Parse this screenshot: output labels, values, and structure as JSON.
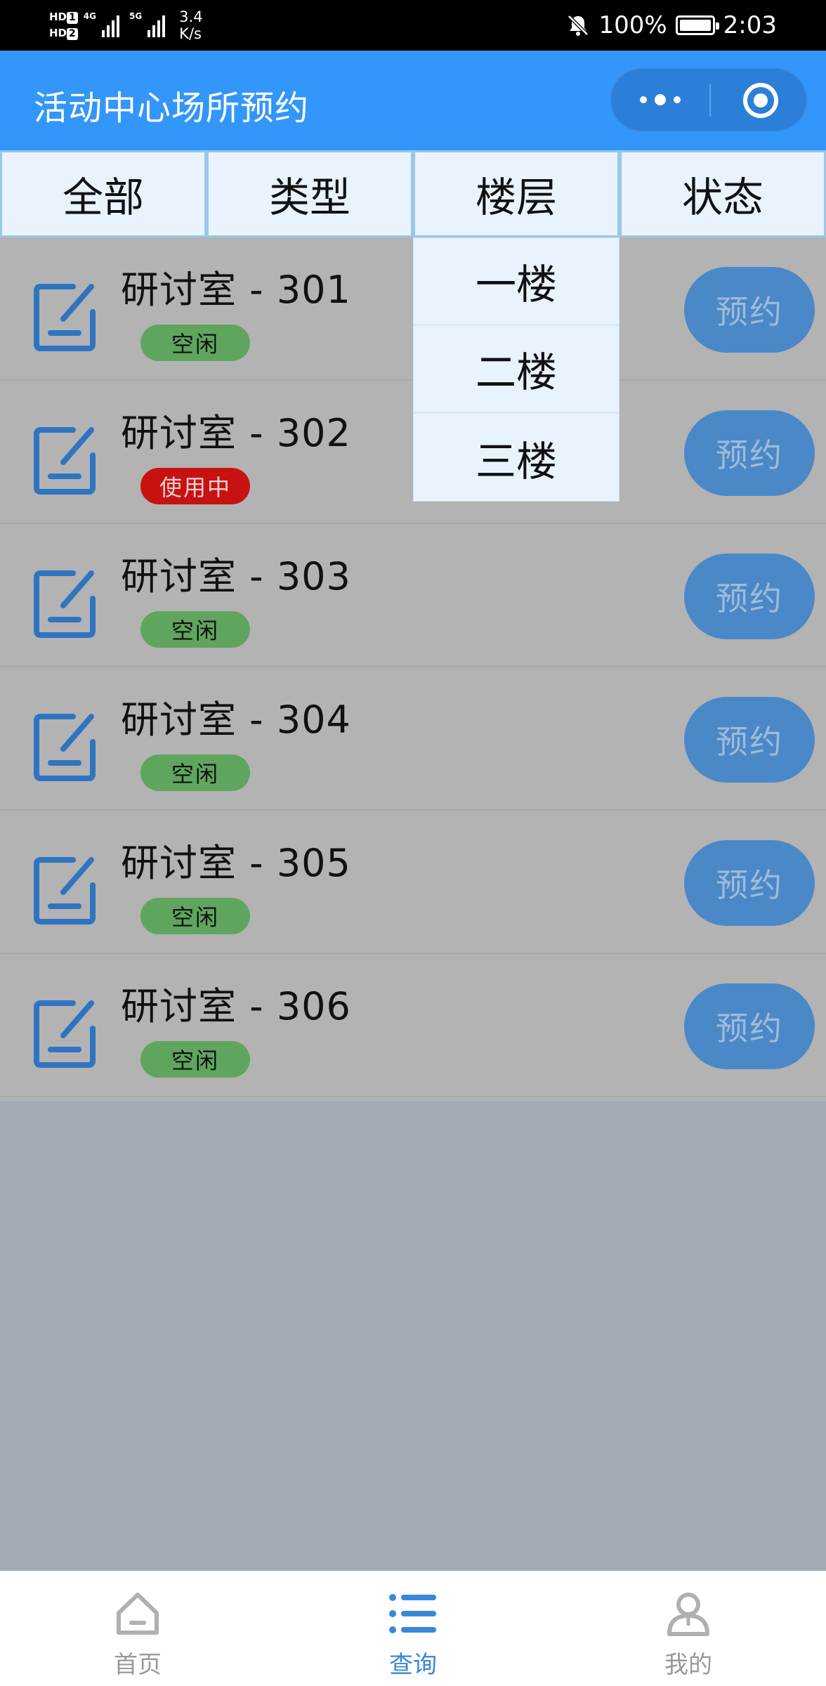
{
  "status_bar": {
    "sim1": "HD",
    "sim1_num": "1",
    "sim2": "HD",
    "sim2_num": "2",
    "net1": "4G",
    "net2": "5G",
    "speed_value": "3.4",
    "speed_unit": "K/s",
    "battery": "100%",
    "time": "2:03"
  },
  "header": {
    "title": "活动中心场所预约",
    "capsule_icons": [
      "more-icon",
      "target-icon"
    ]
  },
  "filter_tabs": [
    {
      "label": "全部"
    },
    {
      "label": "类型"
    },
    {
      "label": "楼层"
    },
    {
      "label": "状态"
    }
  ],
  "dropdown": {
    "options": [
      {
        "label": "一楼"
      },
      {
        "label": "二楼"
      },
      {
        "label": "三楼"
      }
    ]
  },
  "rooms": [
    {
      "name": "研讨室 - 301",
      "status": "空闲",
      "button": "预约"
    },
    {
      "name": "研讨室 - 302",
      "status": "使用中",
      "button": "预约"
    },
    {
      "name": "研讨室 - 303",
      "status": "空闲",
      "button": "预约"
    },
    {
      "name": "研讨室 - 304",
      "status": "空闲",
      "button": "预约"
    },
    {
      "name": "研讨室 - 305",
      "status": "空闲",
      "button": "预约"
    },
    {
      "name": "研讨室 - 306",
      "status": "空闲",
      "button": "预约"
    }
  ],
  "tabbar": [
    {
      "label": "首页",
      "icon": "home-icon"
    },
    {
      "label": "查询",
      "icon": "list-icon"
    },
    {
      "label": "我的",
      "icon": "user-icon"
    }
  ],
  "colors": {
    "primary": "#3296fa",
    "free": "#5fa55e",
    "busy": "#c81212",
    "active_tab": "#3a87d6",
    "inactive_tab": "#999999"
  }
}
